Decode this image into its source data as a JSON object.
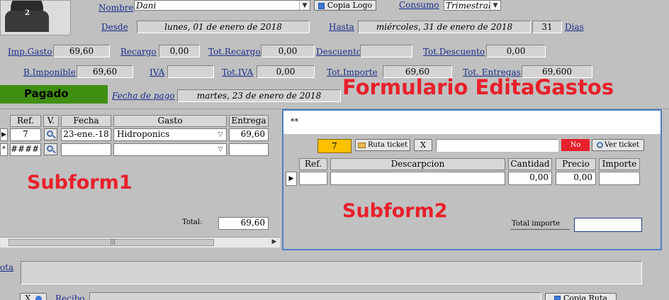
{
  "header": {
    "nombre_label": "Nombre",
    "nombre_value": "Dani",
    "copia_logo_btn": "Copia Logo",
    "consumo_label": "Consumo",
    "consumo_value": "Trimestral",
    "desde_label": "Desde",
    "desde_value": "lunes, 01 de enero de 2018",
    "hasta_label": "Hasta",
    "hasta_value": "miércoles, 31 de enero de 2018",
    "dias_value": "31",
    "dias_label": "Dias"
  },
  "totals": {
    "imp_gasto_label": "Imp.Gasto",
    "imp_gasto_value": "69,60",
    "recargo_label": "Recargo",
    "recargo_value": "0,00",
    "tot_recargo_label": "Tot.Recargo",
    "tot_recargo_value": "0,00",
    "descuento_label": "Descuento",
    "descuento_value": "",
    "tot_descuento_label": "Tot.Descuento",
    "tot_descuento_value": "0,00",
    "b_imponible_label": "B.Imponible",
    "b_imponible_value": "69,60",
    "iva_label": "IVA",
    "iva_value": "",
    "tot_iva_label": "Tot.IVA",
    "tot_iva_value": "0,00",
    "tot_importe_label": "Tot.Importe",
    "tot_importe_value": "69,60",
    "tot_entregas_label": "Tot. Entregas",
    "tot_entregas_value": "69,600"
  },
  "status": {
    "pagado": "Pagado",
    "fecha_pago_label": "Fecha de pago",
    "fecha_pago_value": "martes, 23 de enero de 2018"
  },
  "annotations": {
    "form_title": "Formulario EditaGastos",
    "subform1": "Subform1",
    "subform2": "Subform2"
  },
  "subform1": {
    "columns": [
      "Ref.",
      "V.",
      "Fecha",
      "Gasto",
      "Entrega"
    ],
    "row1": {
      "ref": "7",
      "fecha": "23-ene.-18",
      "gasto": "Hidroponics",
      "entrega": "69,60"
    },
    "row2": {
      "ref": "#####",
      "fecha": "",
      "gasto": "",
      "entrega": ""
    },
    "total_label": "Total:",
    "total_value": "69,60"
  },
  "subform2": {
    "title": "**",
    "ref_value": "7",
    "ruta_ticket_btn": "Ruta ticket",
    "clear_btn": "X",
    "no_badge": "No",
    "ver_ticket_btn": "Ver ticket",
    "columns": [
      "Ref.",
      "Descarpcion",
      "Cantidad",
      "Precio",
      "Importe"
    ],
    "row": {
      "ref": "",
      "descripcion": "",
      "cantidad": "0,00",
      "precio": "0,00",
      "importe": ""
    },
    "total_importe_label": "Total importe",
    "total_importe_value": ""
  },
  "bottom": {
    "nota_label": "ota",
    "recibo_label": "Recibo",
    "recibo_value": "",
    "x_btn": "X",
    "copia_ruta_btn": "Copia Ruta"
  },
  "colors": {
    "pagado_bg": "#3f8f12",
    "title_red": "#e8202a",
    "label_blue": "#1a2c8a",
    "ref_orange": "#ffc000",
    "no_red": "#e8202a"
  }
}
